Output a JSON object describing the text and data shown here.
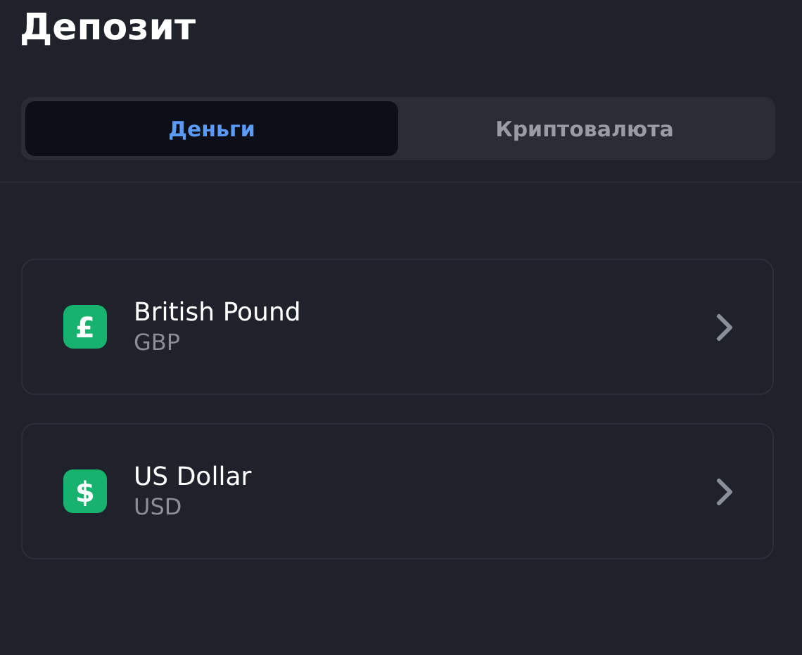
{
  "title": "Депозит",
  "tabs": [
    {
      "label": "Деньги",
      "selected": true
    },
    {
      "label": "Криптовалюта",
      "selected": false
    }
  ],
  "currencies": [
    {
      "symbol": "£",
      "name": "British Pound",
      "code": "GBP"
    },
    {
      "symbol": "$",
      "name": "US Dollar",
      "code": "USD"
    }
  ]
}
